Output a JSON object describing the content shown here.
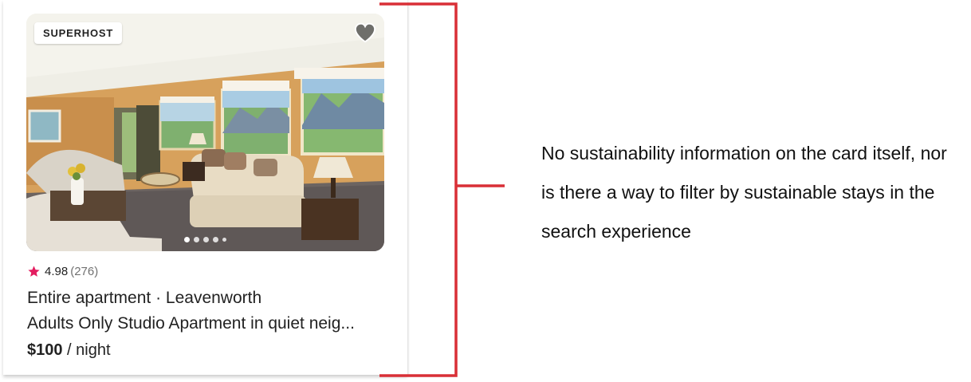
{
  "listing": {
    "badge": "SUPERHOST",
    "favorite_icon": "heart-icon",
    "rating": "4.98",
    "reviews": "(276)",
    "type_location": "Entire apartment · Leavenworth",
    "title": "Adults Only Studio Apartment in quiet neig...",
    "price": "$100",
    "price_unit": " / night",
    "photo_count": 5,
    "active_photo": 1
  },
  "annotation": {
    "text": "No sustainability information on the card itself, nor is there a way to filter by sustainable stays in the search experience"
  },
  "colors": {
    "accent_red": "#d92f36",
    "star": "#e31c5f"
  }
}
